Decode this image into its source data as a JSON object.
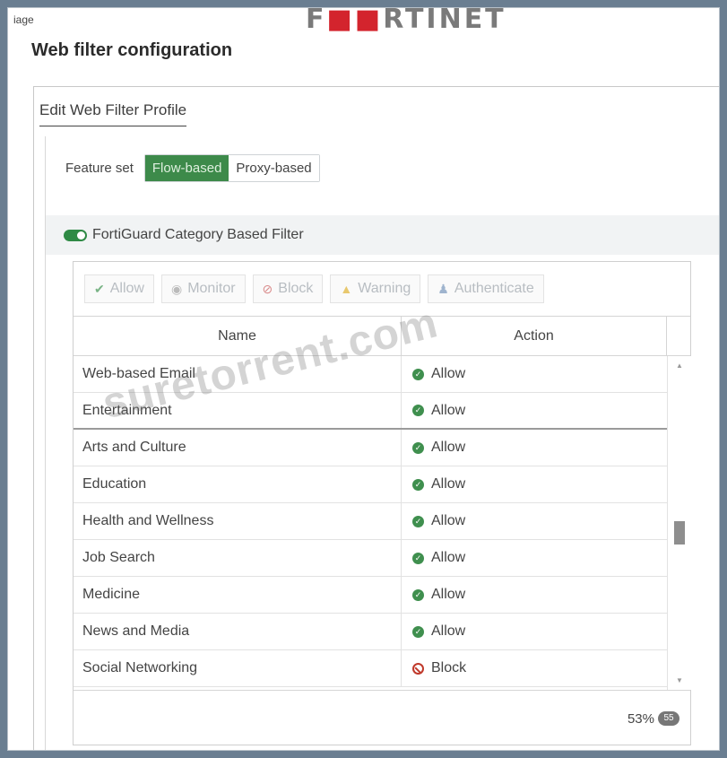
{
  "topbar": {
    "fragment": "iage"
  },
  "logo": "FORTINET",
  "page_title": "Web filter configuration",
  "panel_title": "Edit Web Filter Profile",
  "feature_set": {
    "label": "Feature set",
    "options": [
      "Flow-based",
      "Proxy-based"
    ],
    "selected": "Flow-based"
  },
  "fortiguard": {
    "label": "FortiGuard Category Based Filter",
    "enabled": true
  },
  "actions": [
    "Allow",
    "Monitor",
    "Block",
    "Warning",
    "Authenticate"
  ],
  "table": {
    "columns": [
      "Name",
      "Action"
    ],
    "rows": [
      {
        "name": "Web-based Email",
        "action": "Allow"
      },
      {
        "name": "Entertainment",
        "action": "Allow"
      },
      {
        "name": "Arts and Culture",
        "action": "Allow"
      },
      {
        "name": "Education",
        "action": "Allow"
      },
      {
        "name": "Health and Wellness",
        "action": "Allow"
      },
      {
        "name": "Job Search",
        "action": "Allow"
      },
      {
        "name": "Medicine",
        "action": "Allow"
      },
      {
        "name": "News and Media",
        "action": "Allow"
      },
      {
        "name": "Social Networking",
        "action": "Block"
      }
    ]
  },
  "footer": {
    "percent": "53%",
    "badge": "55"
  },
  "watermark": "suretorrent.com",
  "colors": {
    "accent": "#3d8a4a",
    "block": "#c0392b"
  }
}
